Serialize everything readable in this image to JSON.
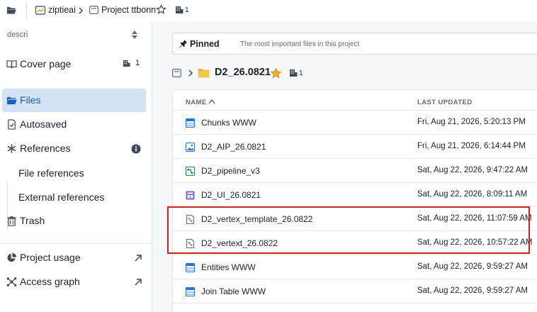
{
  "breadcrumb": {
    "org": "ziptieai",
    "project": "Project ttbonn",
    "resource_count": "1"
  },
  "sidebar": {
    "filter_text": "descri",
    "items": [
      {
        "label": "Cover page",
        "count": "1"
      },
      {
        "label": "Files"
      },
      {
        "label": "Autosaved"
      },
      {
        "label": "References"
      },
      {
        "label": "File references"
      },
      {
        "label": "External references"
      },
      {
        "label": "Trash"
      },
      {
        "label": "Project usage"
      },
      {
        "label": "Access graph"
      }
    ]
  },
  "pinned": {
    "title": "Pinned",
    "description": "The most important files in this project"
  },
  "folder": {
    "name": "D2_26.0821",
    "resource_count": "1"
  },
  "table": {
    "headers": {
      "name": "NAME",
      "updated": "LAST UPDATED"
    },
    "rows": [
      {
        "name": "Chunks WWW",
        "date": "Fri, Aug 21, 2026, 5:20:13 PM",
        "icon": "dataset-icon"
      },
      {
        "name": "D2_AIP_26.0821",
        "date": "Fri, Aug 21, 2026, 6:14:44 PM",
        "icon": "image-icon"
      },
      {
        "name": "D2_pipeline_v3",
        "date": "Sat, Aug 22, 2026, 9:47:22 AM",
        "icon": "pipeline-icon"
      },
      {
        "name": "D2_UI_26.0821",
        "date": "Sat, Aug 22, 2026, 8:09:11 AM",
        "icon": "app-icon"
      },
      {
        "name": "D2_vertex_template_26.0822",
        "date": "Sat, Aug 22, 2026, 11:07:59 AM",
        "icon": "vertex-file-icon"
      },
      {
        "name": "D2_vertext_26.0822",
        "date": "Sat, Aug 22, 2026, 10:57:22 AM",
        "icon": "vertex-file-icon"
      },
      {
        "name": "Entities WWW",
        "date": "Sat, Aug 22, 2026, 9:59:27 AM",
        "icon": "dataset-icon"
      },
      {
        "name": "Join Table WWW",
        "date": "Sat, Aug 22, 2026, 9:59:27 AM",
        "icon": "dataset-icon"
      }
    ]
  },
  "colors": {
    "accent": "#215db0",
    "active_bg": "#d3e2f4",
    "folder": "#f0b429",
    "star": "#f0b429",
    "highlight": "#d0202a"
  }
}
